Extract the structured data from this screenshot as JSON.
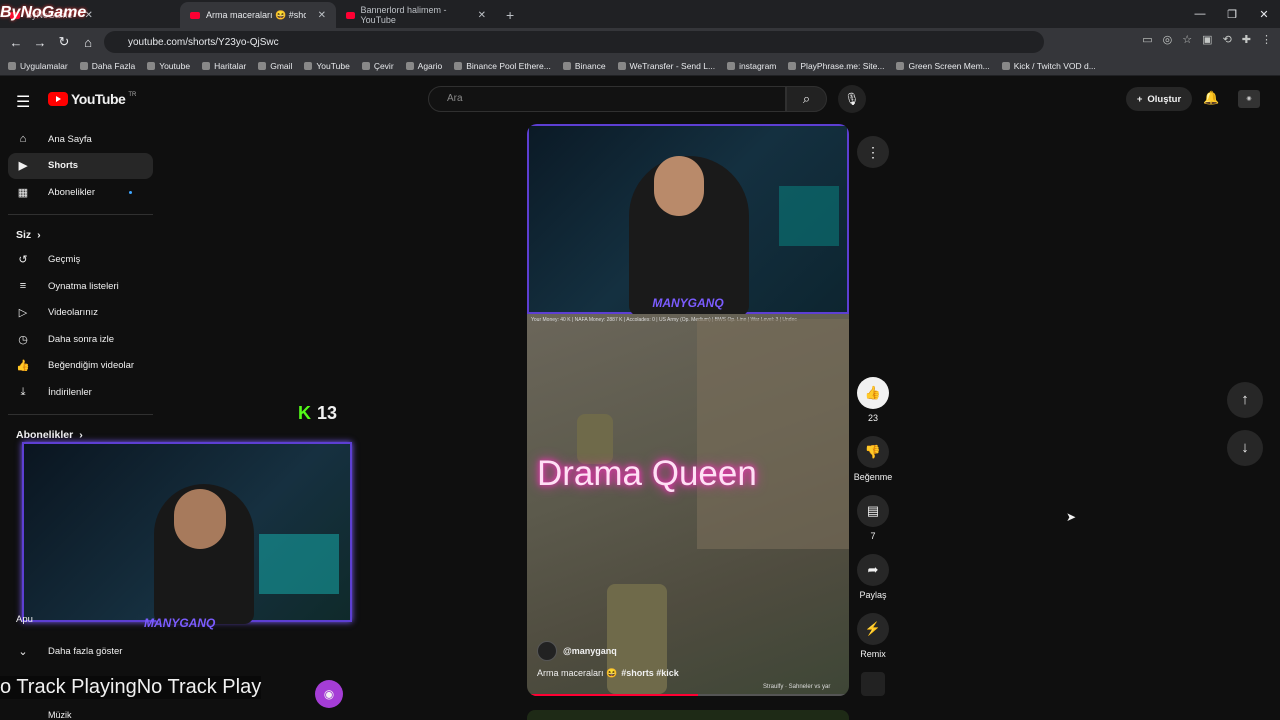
{
  "browser": {
    "tabs": [
      {
        "title": "ByNoGame",
        "active": false
      },
      {
        "title": "Arma maceraları 😆 #shorts",
        "active": true
      },
      {
        "title": "Bannerlord halimem - YouTube",
        "active": false
      }
    ],
    "url": "youtube.com/shorts/Y23yo-QjSwc",
    "bookmarks": [
      "Uygulamalar",
      "Daha Fazla",
      "Youtube",
      "Haritalar",
      "Gmail",
      "YouTube",
      "Çevir",
      "Agario",
      "Binance Pool Ethere...",
      "Binance",
      "WeTransfer - Send L...",
      "instagram",
      "PlayPhrase.me: Site...",
      "Green Screen Mem...",
      "Kick / Twitch VOD d..."
    ]
  },
  "overlay_logo": "ByNoGame",
  "youtube": {
    "logo": "YouTube",
    "country": "TR",
    "search_placeholder": "Ara",
    "create_label": "Oluştur",
    "sidebar_top": [
      {
        "label": "Ana Sayfa",
        "icon": "home-icon"
      },
      {
        "label": "Shorts",
        "icon": "shorts-icon",
        "selected": true
      },
      {
        "label": "Abonelikler",
        "icon": "subscriptions-icon"
      }
    ],
    "you_section": "Siz",
    "sidebar_you": [
      {
        "label": "Geçmiş",
        "icon": "history-icon"
      },
      {
        "label": "Oynatma listeleri",
        "icon": "playlist-icon"
      },
      {
        "label": "Videolarınız",
        "icon": "video-icon"
      },
      {
        "label": "Daha sonra izle",
        "icon": "clock-icon"
      },
      {
        "label": "Beğendiğim videolar",
        "icon": "like-icon"
      },
      {
        "label": "İndirilenler",
        "icon": "download-icon"
      }
    ],
    "subs_section": "Abonelikler",
    "sub_partial": "Apu",
    "show_more": "Daha fazla göster",
    "music": "Müzik",
    "short": {
      "cam_tag": "MANYGANQ",
      "hud": "Your Money: 40 K | NAFA Money: 2887 K | Accolades: 0 | US Army (Op. Medium) | BWS Op. Line | War Level: 3 | Undec",
      "overlay_text": "Drama Queen",
      "channel": "@manyganq",
      "caption": "Arma maceraları 😆",
      "hashtags": "#shorts #kick",
      "music_credit": "Straulfy · Sahneler vs yar",
      "progress": 0.53
    },
    "actions": {
      "likes": "23",
      "dislike_label": "Beğenme",
      "comments": "7",
      "share_label": "Paylaş",
      "remix_label": "Remix"
    }
  },
  "stream_overlay": {
    "kick_count": "13",
    "webcam_tag": "MANYGANQ",
    "ticker": "o Track PlayingNo Track Play"
  }
}
